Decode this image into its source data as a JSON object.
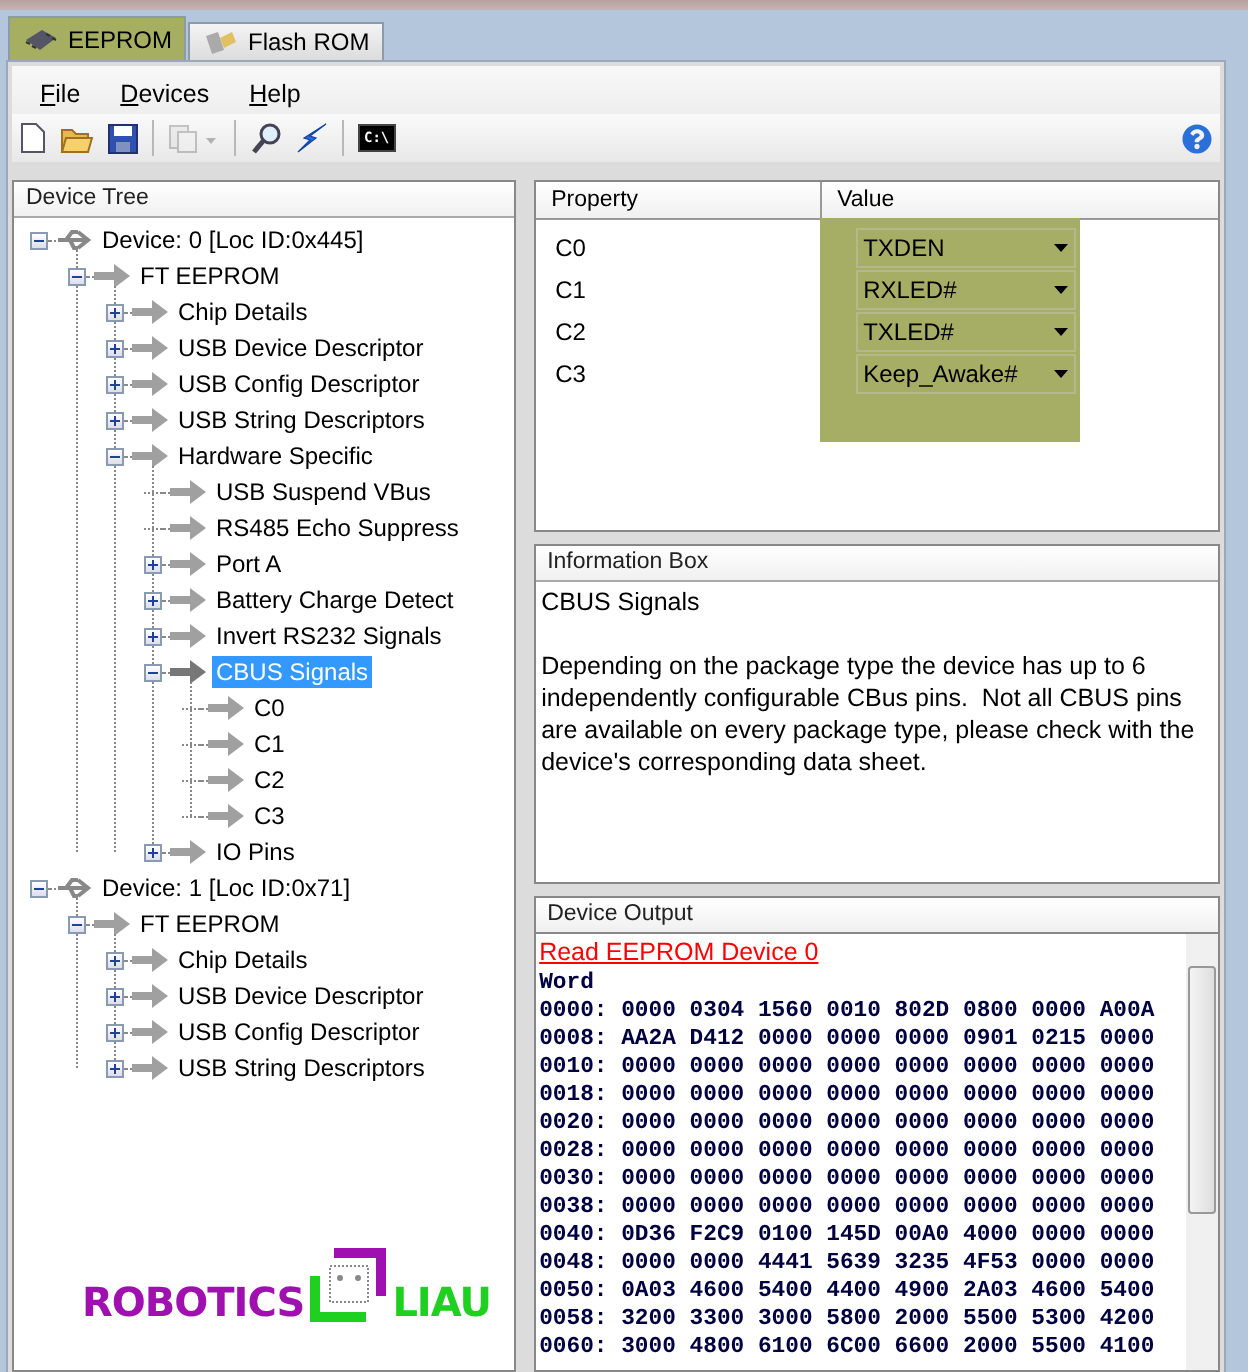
{
  "tabs": [
    {
      "label": "EEPROM",
      "selected": true,
      "kind": "chip"
    },
    {
      "label": "Flash ROM",
      "selected": false,
      "kind": "flash"
    }
  ],
  "menu": [
    "File",
    "Devices",
    "Help"
  ],
  "toolbar": [
    {
      "kind": "new",
      "disabled": false
    },
    {
      "kind": "open",
      "disabled": false
    },
    {
      "kind": "save",
      "disabled": false
    },
    {
      "kind": "separator"
    },
    {
      "kind": "copy",
      "disabled": true
    },
    {
      "kind": "separator"
    },
    {
      "kind": "search",
      "disabled": false
    },
    {
      "kind": "flash",
      "disabled": false
    },
    {
      "kind": "separator"
    },
    {
      "kind": "console",
      "disabled": false,
      "label": "C:\\"
    },
    {
      "kind": "help",
      "disabled": false
    }
  ],
  "device_tree": {
    "title": "Device Tree",
    "items": [
      {
        "label": "Device: 0 [Loc ID:0x445]",
        "kind": "device",
        "expanded": true,
        "selected": false,
        "children": [
          {
            "label": "FT EEPROM",
            "kind": "node",
            "expanded": true,
            "selected": false,
            "children": [
              {
                "label": "Chip Details",
                "kind": "node",
                "expanded": false,
                "selected": false
              },
              {
                "label": "USB Device Descriptor",
                "kind": "node",
                "expanded": false,
                "selected": false
              },
              {
                "label": "USB Config Descriptor",
                "kind": "node",
                "expanded": false,
                "selected": false
              },
              {
                "label": "USB String Descriptors",
                "kind": "node",
                "expanded": false,
                "selected": false
              },
              {
                "label": "Hardware Specific",
                "kind": "node",
                "expanded": true,
                "selected": false,
                "children": [
                  {
                    "label": "USB Suspend VBus",
                    "kind": "leaf",
                    "selected": false
                  },
                  {
                    "label": "RS485 Echo Suppress",
                    "kind": "leaf",
                    "selected": false
                  },
                  {
                    "label": "Port A",
                    "kind": "node",
                    "expanded": false,
                    "selected": false
                  },
                  {
                    "label": "Battery Charge Detect",
                    "kind": "node",
                    "expanded": false,
                    "selected": false
                  },
                  {
                    "label": "Invert RS232 Signals",
                    "kind": "node",
                    "expanded": false,
                    "selected": false
                  },
                  {
                    "label": "CBUS Signals",
                    "kind": "node",
                    "expanded": true,
                    "selected": true,
                    "children": [
                      {
                        "label": "C0",
                        "kind": "leaf",
                        "selected": false
                      },
                      {
                        "label": "C1",
                        "kind": "leaf",
                        "selected": false
                      },
                      {
                        "label": "C2",
                        "kind": "leaf",
                        "selected": false
                      },
                      {
                        "label": "C3",
                        "kind": "leaf",
                        "selected": false
                      }
                    ]
                  },
                  {
                    "label": "IO Pins",
                    "kind": "node",
                    "expanded": false,
                    "selected": false
                  }
                ]
              }
            ]
          }
        ]
      },
      {
        "label": "Device: 1 [Loc ID:0x71]",
        "kind": "device",
        "expanded": true,
        "selected": false,
        "children": [
          {
            "label": "FT EEPROM",
            "kind": "node",
            "expanded": true,
            "selected": false,
            "children": [
              {
                "label": "Chip Details",
                "kind": "node",
                "expanded": false,
                "selected": false
              },
              {
                "label": "USB Device Descriptor",
                "kind": "node",
                "expanded": false,
                "selected": false
              },
              {
                "label": "USB Config Descriptor",
                "kind": "node",
                "expanded": false,
                "selected": false
              },
              {
                "label": "USB String Descriptors",
                "kind": "node",
                "expanded": false,
                "selected": false
              }
            ]
          }
        ]
      }
    ]
  },
  "logo": {
    "left": "ROBOTICS",
    "right": "LIAU"
  },
  "properties": {
    "columns": [
      "Property",
      "Value"
    ],
    "rows": [
      {
        "property": "C0",
        "value": "TXDEN"
      },
      {
        "property": "C1",
        "value": "RXLED#"
      },
      {
        "property": "C2",
        "value": "TXLED#"
      },
      {
        "property": "C3",
        "value": "Keep_Awake#"
      }
    ]
  },
  "information_box": {
    "title": "Information Box",
    "heading": "CBUS Signals",
    "body": "Depending on the package type the device has up to 6 independently configurable CBus pins.  Not all CBUS pins are available on every package type, please check with the device's corresponding data sheet."
  },
  "device_output": {
    "title": "Device Output",
    "link": "Read EEPROM Device 0",
    "caption": "Word",
    "lines": [
      "0000: 0000 0304 1560 0010 802D 0800 0000 A00A",
      "0008: AA2A D412 0000 0000 0000 0901 0215 0000",
      "0010: 0000 0000 0000 0000 0000 0000 0000 0000",
      "0018: 0000 0000 0000 0000 0000 0000 0000 0000",
      "0020: 0000 0000 0000 0000 0000 0000 0000 0000",
      "0028: 0000 0000 0000 0000 0000 0000 0000 0000",
      "0030: 0000 0000 0000 0000 0000 0000 0000 0000",
      "0038: 0000 0000 0000 0000 0000 0000 0000 0000",
      "0040: 0D36 F2C9 0100 145D 00A0 4000 0000 0000",
      "0048: 0000 0000 4441 5639 3235 4F53 0000 0000",
      "0050: 0A03 4600 5400 4400 4900 2A03 4600 5400",
      "0058: 3200 3300 3000 5800 2000 5500 5300 4200",
      "0060: 3000 4800 6100 6C00 6600 2000 5500 4100"
    ]
  }
}
